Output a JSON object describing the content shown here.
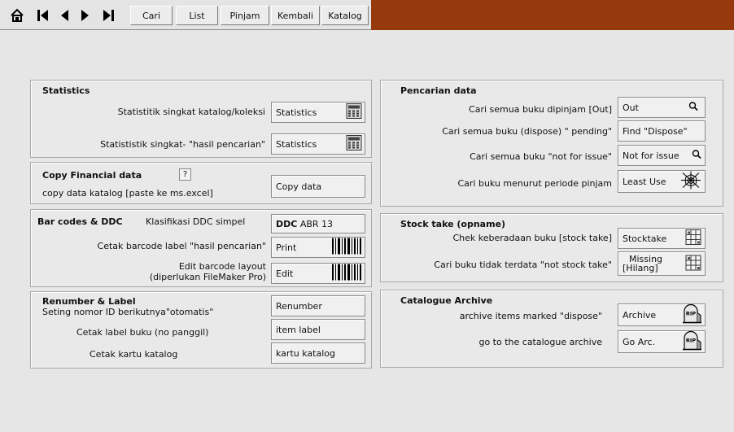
{
  "toolbar": {
    "home_icon": "home-icon",
    "nav_icons": [
      "first-record-icon",
      "prev-record-icon",
      "next-record-icon",
      "last-record-icon"
    ],
    "tabs": [
      "Cari",
      "List",
      "Pinjam",
      "Kembali",
      "Katalog"
    ],
    "accent_color": "#963a0e"
  },
  "statistics": {
    "title": "Statistics",
    "row1_label": "Statistitik singkat katalog/koleksi",
    "row1_button": "Statistics",
    "row2_label": "Statististik singkat- \"hasil pencarian\"",
    "row2_button": "Statistics"
  },
  "copy": {
    "title": "Copy Financial data",
    "help": "?",
    "label": "copy data katalog [paste ke ms.excel]",
    "button": "Copy data"
  },
  "barcode": {
    "title": "Bar codes & DDC",
    "ddc_label": "Klasifikasi DDC simpel",
    "ddc_button_bold": "DDC",
    "ddc_button_rest": " ABR 13",
    "print_label": "Cetak barcode label \"hasil pencarian\"",
    "print_button": "Print",
    "edit_label_1": "Edit barcode layout",
    "edit_label_2": "(diperlukan FileMaker Pro)",
    "edit_button": "Edit"
  },
  "renumber": {
    "title": "Renumber & Label",
    "row1_label": "Seting nomor ID berikutnya\"otomatis\"",
    "row1_button": "Renumber",
    "row2_label": "Cetak  label buku (no panggil)",
    "row2_button": "item label",
    "row3_label": "Cetak  kartu  katalog",
    "row3_button": "kartu katalog"
  },
  "pencarian": {
    "title": "Pencarian data",
    "row1_label": "Cari semua buku dipinjam [Out]",
    "row1_button": "Out",
    "row2_label": "Cari semua buku (dispose) \" pending\"",
    "row2_button": "Find \"Dispose\"",
    "row3_label": "Cari semua buku \"not for issue\"",
    "row3_button": "Not for issue",
    "row4_label": "Cari  buku menurut periode pinjam",
    "row4_button": "Least Use"
  },
  "stocktake": {
    "title": "Stock take (opname)",
    "row1_label": "Chek keberadaan buku [stock take]",
    "row1_button": "Stocktake",
    "row2_label": "Cari buku tidak terdata \"not stock take\"",
    "row2_button_1": "Missing",
    "row2_button_2": "[Hilang]"
  },
  "archive": {
    "title": "Catalogue Archive",
    "row1_label": "archive items marked \"dispose\"",
    "row1_button": "Archive",
    "row2_label": "go to the catalogue archive",
    "row2_button": "Go Arc.",
    "rip_text": "RIP"
  }
}
